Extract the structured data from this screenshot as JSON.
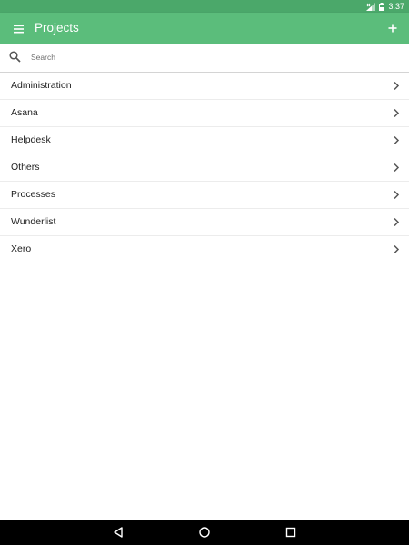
{
  "status_bar": {
    "time": "3:37",
    "icons": [
      "signal-icon",
      "battery-icon"
    ]
  },
  "app_bar": {
    "title": "Projects",
    "menu_icon": "hamburger-menu-icon",
    "add_icon": "plus-icon"
  },
  "search": {
    "placeholder": "Search",
    "value": "",
    "icon": "search-icon"
  },
  "projects": [
    {
      "label": "Administration"
    },
    {
      "label": "Asana"
    },
    {
      "label": "Helpdesk"
    },
    {
      "label": "Others"
    },
    {
      "label": "Processes"
    },
    {
      "label": "Wunderlist"
    },
    {
      "label": "Xero"
    }
  ],
  "nav_bar": {
    "buttons": [
      "back-icon",
      "home-icon",
      "recents-icon"
    ]
  },
  "colors": {
    "status_bar": "#4ba86a",
    "app_bar": "#5bbd7b",
    "nav_bar": "#000000",
    "text": "#212121"
  }
}
